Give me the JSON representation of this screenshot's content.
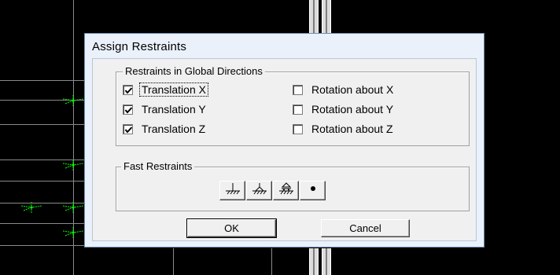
{
  "dialog": {
    "title": "Assign Restraints",
    "global_group": {
      "label": "Restraints in Global Directions",
      "options": [
        {
          "label": "Translation X",
          "checked": true,
          "focused": true
        },
        {
          "label": "Translation Y",
          "checked": true,
          "focused": false
        },
        {
          "label": "Translation Z",
          "checked": true,
          "focused": false
        },
        {
          "label": "Rotation about X",
          "checked": false,
          "focused": false
        },
        {
          "label": "Rotation about Y",
          "checked": false,
          "focused": false
        },
        {
          "label": "Rotation about Z",
          "checked": false,
          "focused": false
        }
      ]
    },
    "fast_group": {
      "label": "Fast Restraints",
      "buttons": [
        {
          "icon": "fixed-support-icon"
        },
        {
          "icon": "pinned-support-icon"
        },
        {
          "icon": "roller-support-icon"
        },
        {
          "icon": "free-joint-icon"
        }
      ]
    },
    "ok_label": "OK",
    "cancel_label": "Cancel"
  },
  "colors": {
    "joint_marker": "#00ff00",
    "grid_line": "#8a8a8a",
    "background": "#000000",
    "dialog_frame": "#eaf1fb"
  }
}
